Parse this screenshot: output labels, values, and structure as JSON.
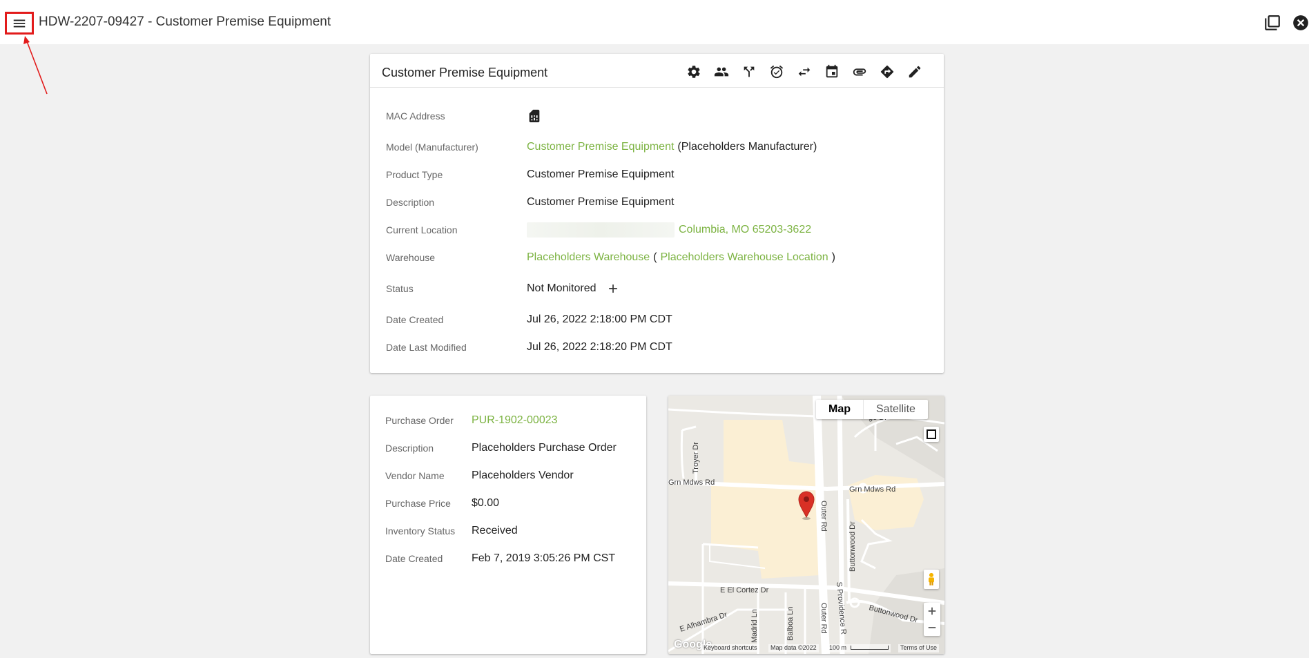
{
  "header": {
    "title": "HDW-2207-09427 - Customer Premise Equipment",
    "menu_icon": "hamburger-menu-icon",
    "right_icons": [
      "open-in-new-window-icon",
      "close-circle-icon"
    ]
  },
  "details": {
    "title": "Customer Premise Equipment",
    "toolbar": [
      "settings-icon",
      "people-icon",
      "merge-icon",
      "alarm-icon",
      "swap-icon",
      "calendar-icon",
      "attachment-icon",
      "directions-icon",
      "edit-icon"
    ],
    "fields": {
      "mac_label": "MAC Address",
      "model_label": "Model (Manufacturer)",
      "model_link": "Customer Premise Equipment",
      "model_manufacturer": "(Placeholders Manufacturer)",
      "product_type_label": "Product Type",
      "product_type": "Customer Premise Equipment",
      "description_label": "Description",
      "description": "Customer Premise Equipment",
      "location_label": "Current Location",
      "location_city": "Columbia, MO 65203-3622",
      "warehouse_label": "Warehouse",
      "warehouse_link": "Placeholders Warehouse",
      "warehouse_open": "(",
      "warehouse_location_link": "Placeholders Warehouse Location",
      "warehouse_close": ")",
      "status_label": "Status",
      "status": "Not Monitored",
      "date_created_label": "Date Created",
      "date_created": "Jul 26, 2022 2:18:00 PM CDT",
      "date_modified_label": "Date Last Modified",
      "date_modified": "Jul 26, 2022 2:18:20 PM CDT"
    }
  },
  "purchase": {
    "po_label": "Purchase Order",
    "po_value": "PUR-1902-00023",
    "description_label": "Description",
    "description": "Placeholders Purchase Order",
    "vendor_label": "Vendor Name",
    "vendor": "Placeholders Vendor",
    "price_label": "Purchase Price",
    "price": "$0.00",
    "inventory_label": "Inventory Status",
    "inventory": "Received",
    "date_created_label": "Date Created",
    "date_created": "Feb 7, 2019 3:05:26 PM CST"
  },
  "map": {
    "type_map": "Map",
    "type_satellite": "Satellite",
    "streets": {
      "troyer": "Troyer Dr",
      "grn_mdws_w": "Grn Mdws Rd",
      "grn_mdws_e": "Grn Mdws Rd",
      "outer_rd_n": "Outer Rd",
      "outer_rd_s": "Outer Rd",
      "buttonwood_dr": "Buttonwood Dr",
      "buttonwood_dr_s": "Buttonwood Dr",
      "el_cortez": "E El Cortez Dr",
      "alhambra": "E Alhambra Dr",
      "madrid": "Madrid Ln",
      "balboa": "Balboa Ln",
      "providence": "S Providence R",
      "ge_dr": "ge Dr"
    },
    "footer": {
      "google": "Google",
      "shortcuts": "Keyboard shortcuts",
      "data": "Map data ©2022",
      "scale": "100 m",
      "terms": "Terms of Use"
    },
    "controls": [
      "fullscreen-icon",
      "pegman-icon",
      "zoom-in-icon",
      "zoom-out-icon"
    ],
    "marker_color": "#d93025"
  },
  "colors": {
    "link": "#7cb342",
    "annotation": "#e21b1b"
  }
}
